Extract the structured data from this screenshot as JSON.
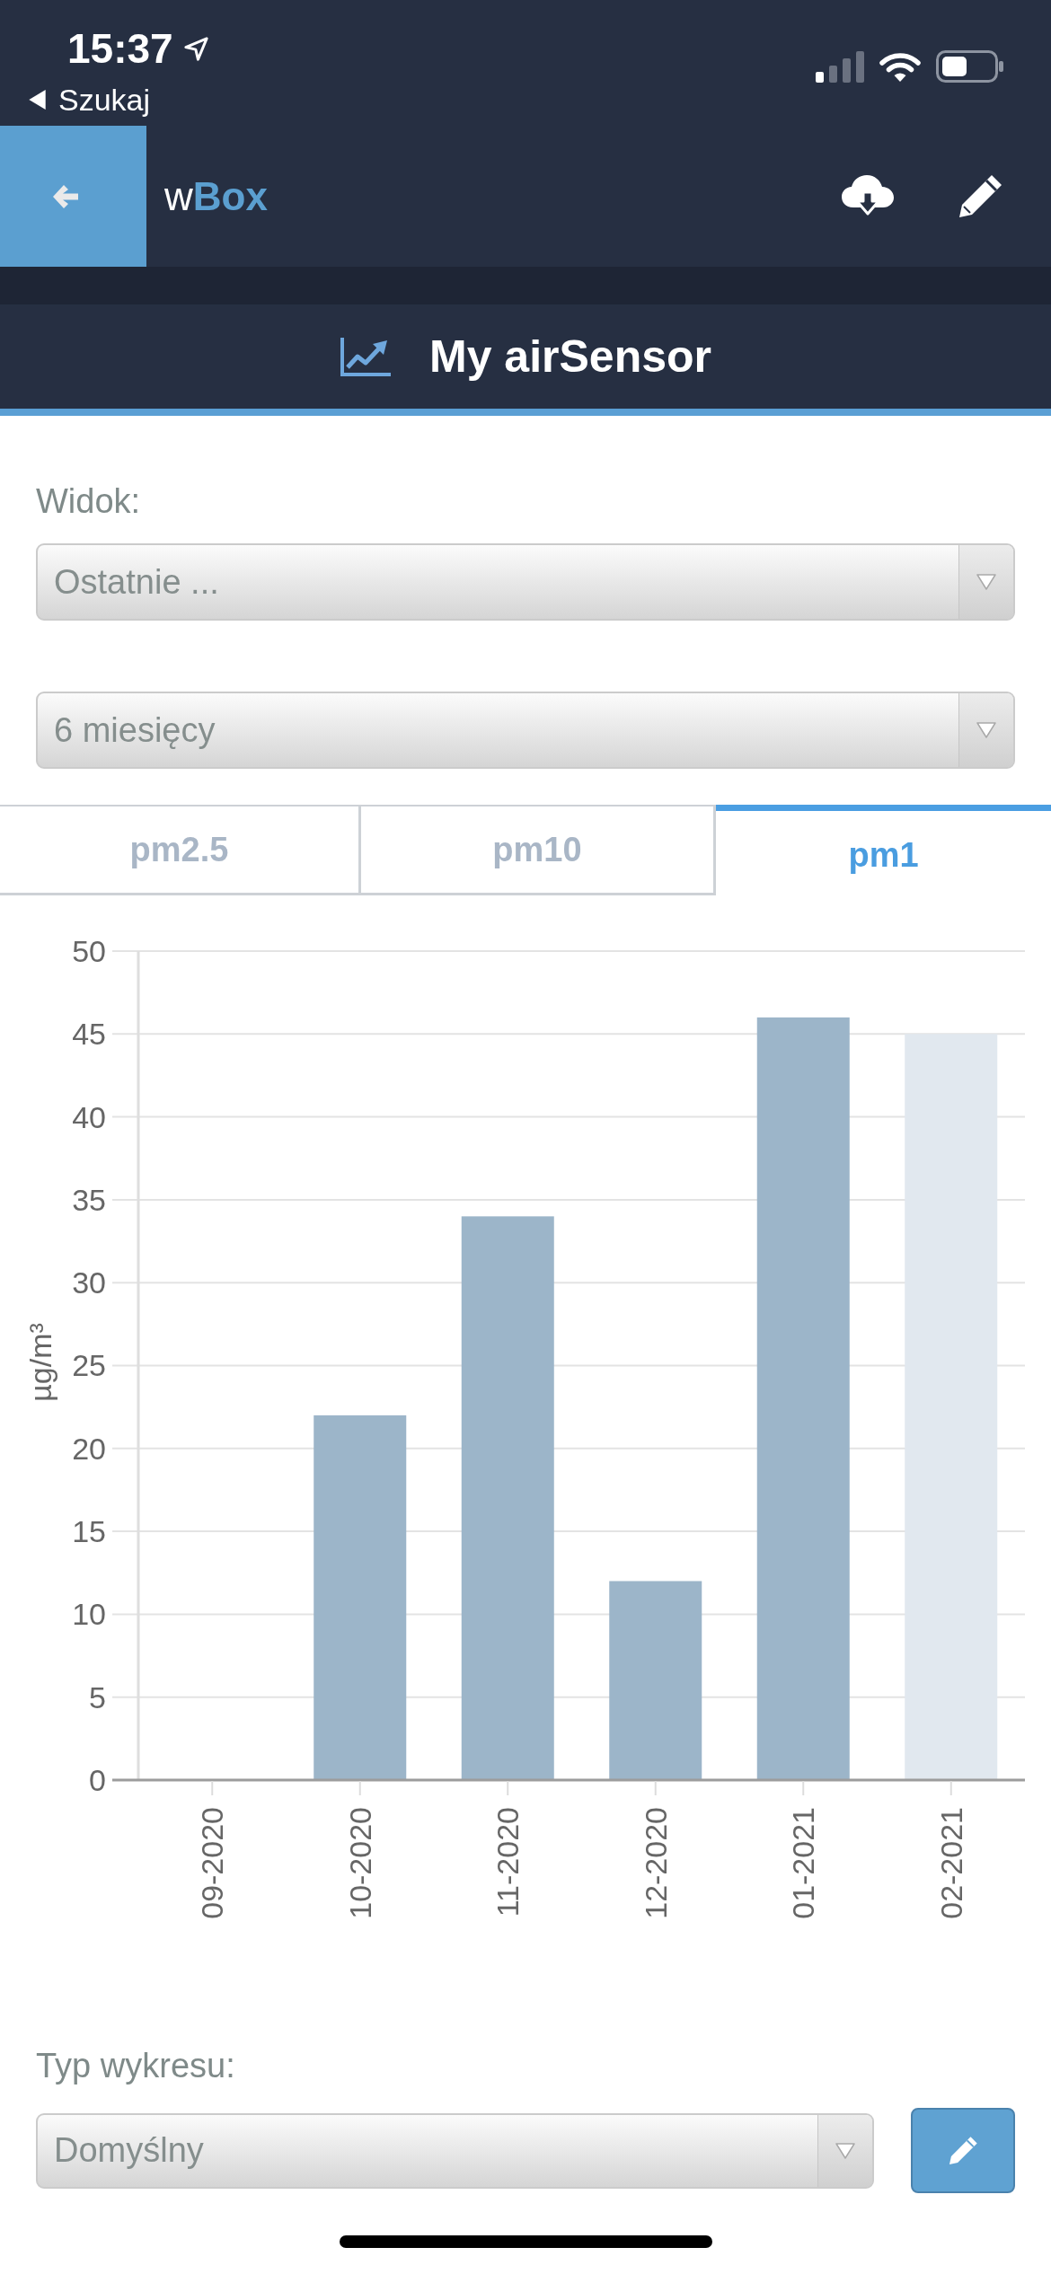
{
  "status_bar": {
    "time": "15:37",
    "back_label": "Szukaj"
  },
  "header": {
    "title": "w**Box**"
  },
  "title_bar": {
    "title": "My airSensor"
  },
  "view": {
    "label": "Widok:",
    "selects": [
      {
        "value": "Ostatnie ..."
      },
      {
        "value": "6 miesięcy"
      }
    ]
  },
  "tabs": [
    {
      "label": "pm2.5",
      "selected": false
    },
    {
      "label": "pm10",
      "selected": false
    },
    {
      "label": "pm1",
      "selected": true
    }
  ],
  "chart": {
    "chart_data": {
      "type": "bar",
      "ylabel": "µg/m³",
      "categories": [
        "09-2020",
        "10-2020",
        "11-2020",
        "12-2020",
        "01-2021",
        "02-2021"
      ],
      "series": [
        {
          "color": "#9cb5c9",
          "values": [
            null,
            22,
            34,
            12,
            46,
            null
          ]
        },
        {
          "color": "#e1e8ef",
          "values": [
            null,
            null,
            null,
            null,
            null,
            45
          ]
        }
      ],
      "ylim": [
        0,
        50
      ],
      "yticks": [
        0,
        5,
        10,
        15,
        20,
        25,
        30,
        35,
        40,
        45,
        50
      ],
      "stacked": true,
      "grid": true
    }
  },
  "chart_type": {
    "label": "Typ wykresu:",
    "select": {
      "value": "Domyślny"
    }
  }
}
